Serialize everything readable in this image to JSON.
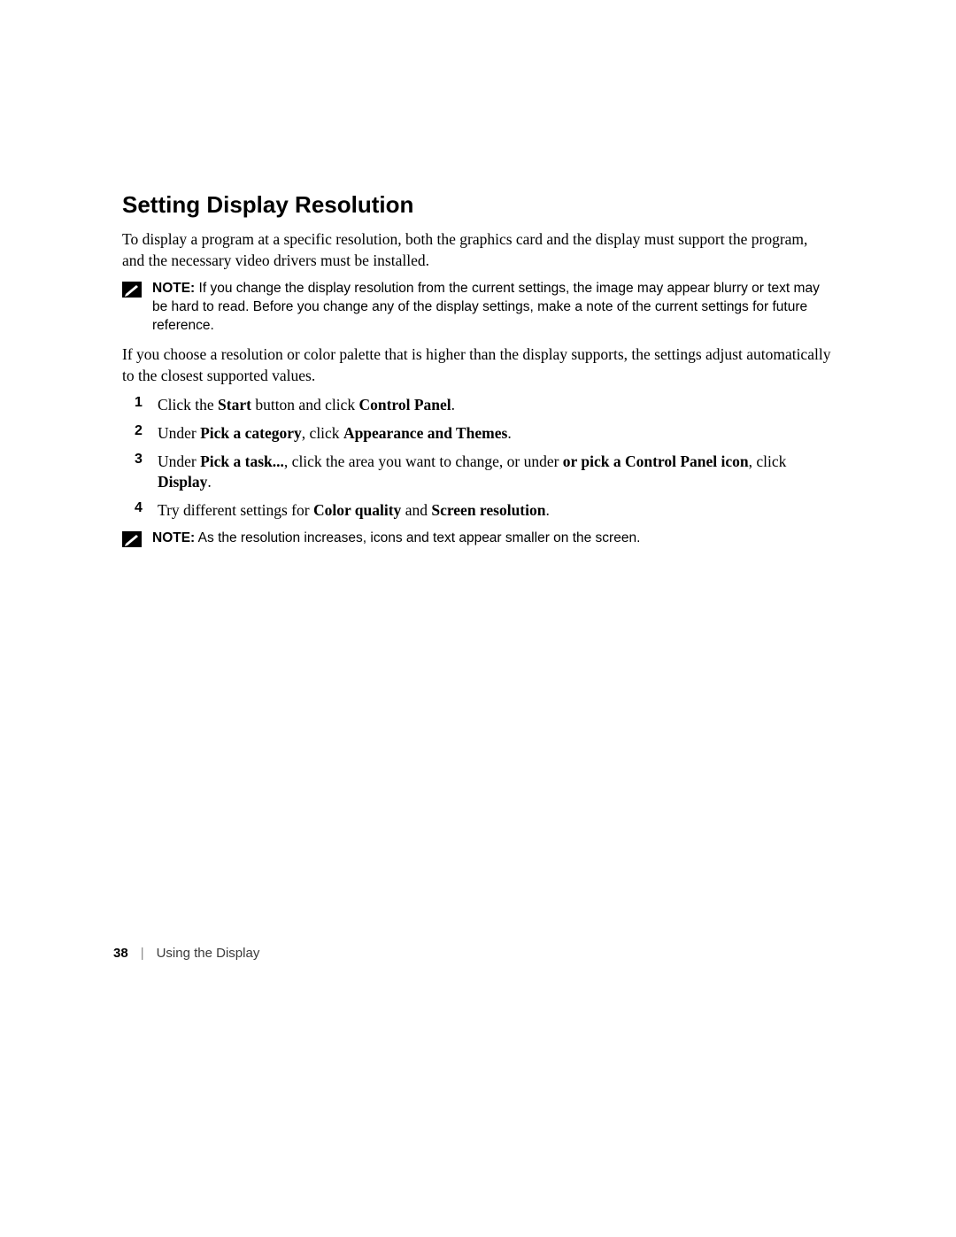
{
  "heading": "Setting Display Resolution",
  "para1": "To display a program at a specific resolution, both the graphics card and the display must support the program, and the necessary video drivers must be installed.",
  "note1": {
    "label": "NOTE:",
    "text": " If you change the display resolution from the current settings, the image may appear blurry or text may be hard to read. Before you change any of the display settings, make a note of the current settings for future reference."
  },
  "para2": "If you choose a resolution or color palette that is higher than the display supports, the settings adjust automatically to the closest supported values.",
  "steps": {
    "s1": {
      "num": "1",
      "t1": "Click the ",
      "b1": "Start",
      "t2": " button and click ",
      "b2": "Control Panel",
      "t3": "."
    },
    "s2": {
      "num": "2",
      "t1": "Under ",
      "b1": "Pick a category",
      "t2": ", click ",
      "b2": "Appearance and Themes",
      "t3": "."
    },
    "s3": {
      "num": "3",
      "t1": "Under ",
      "b1": "Pick a task...",
      "t2": ", click the area you want to change, or under ",
      "b2": "or pick a Control Panel icon",
      "t3": ", click ",
      "b3": "Display",
      "t4": "."
    },
    "s4": {
      "num": "4",
      "t1": "Try different settings for ",
      "b1": "Color quality",
      "t2": " and ",
      "b2": "Screen resolution",
      "t3": "."
    }
  },
  "note2": {
    "label": "NOTE:",
    "text": " As the resolution increases, icons and text appear smaller on the screen."
  },
  "footer": {
    "page": "38",
    "sep": "|",
    "title": "Using the Display"
  }
}
